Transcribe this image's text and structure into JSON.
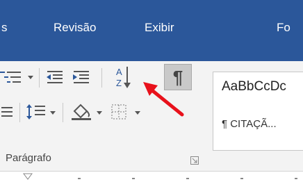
{
  "tabs": [
    {
      "label": "s"
    },
    {
      "label": "Revisão"
    },
    {
      "label": "Exibir"
    },
    {
      "label": "Fo"
    }
  ],
  "group": {
    "label": "Parágrafo"
  },
  "styles": {
    "sample": "AaBbCcDc",
    "name": "¶ CITAÇÃ..."
  },
  "icons": {
    "sort": "sort-az-icon",
    "pilcrow": "show-formatting-icon",
    "arrow": "red-pointer-arrow"
  },
  "colors": {
    "tabbar": "#2b579a",
    "ribbon": "#f3f3f3",
    "sort_blue": "#2b579a",
    "arrow": "#e8111b"
  }
}
